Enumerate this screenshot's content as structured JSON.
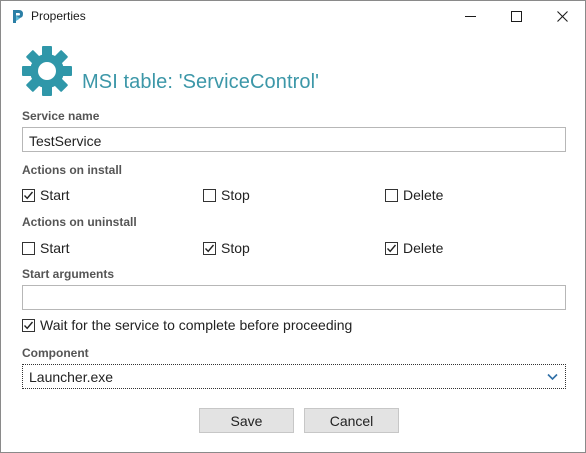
{
  "window": {
    "title": "Properties"
  },
  "header": {
    "title": "MSI table: 'ServiceControl'",
    "accent_color": "#3c97a8",
    "icon": "gear-icon"
  },
  "service_name": {
    "label": "Service name",
    "value": "TestService"
  },
  "actions_on_install": {
    "label": "Actions on install",
    "start": {
      "label": "Start",
      "checked": true
    },
    "stop": {
      "label": "Stop",
      "checked": false
    },
    "delete": {
      "label": "Delete",
      "checked": false
    }
  },
  "actions_on_uninstall": {
    "label": "Actions on uninstall",
    "start": {
      "label": "Start",
      "checked": false
    },
    "stop": {
      "label": "Stop",
      "checked": true
    },
    "delete": {
      "label": "Delete",
      "checked": true
    }
  },
  "start_arguments": {
    "label": "Start arguments",
    "value": ""
  },
  "wait_option": {
    "label": "Wait for the service to complete before proceeding",
    "checked": true
  },
  "component": {
    "label": "Component",
    "value": "Launcher.exe"
  },
  "buttons": {
    "save": "Save",
    "cancel": "Cancel"
  }
}
